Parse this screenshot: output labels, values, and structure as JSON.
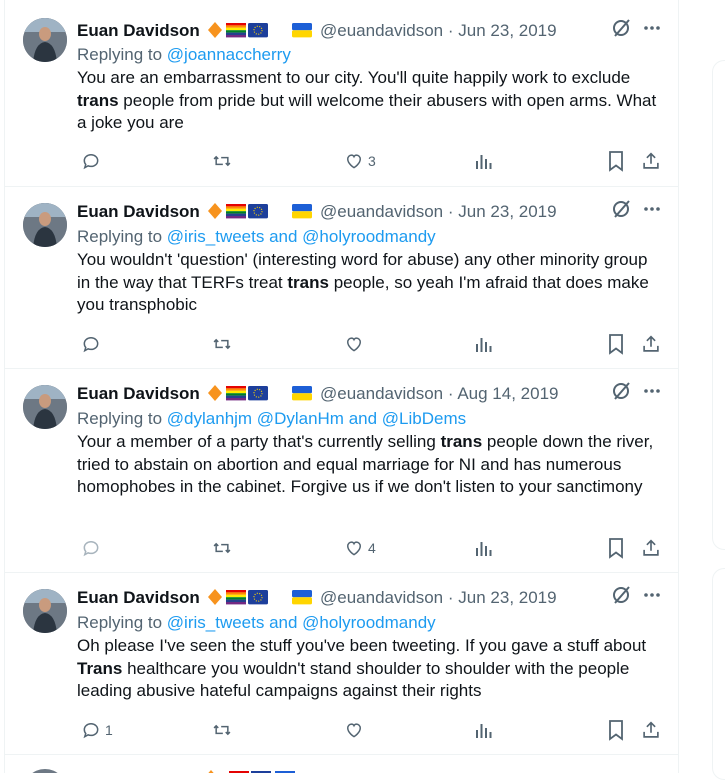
{
  "tweets": [
    {
      "name": "Euan Davidson",
      "handle": "@euandavidson",
      "date": "· Jun 23, 2019",
      "reply_prefix": "Replying to",
      "reply_to": "@joannaccherry",
      "text_parts": [
        "You are an embarrassment to our city. You'll quite happily work to exclude ",
        "trans",
        " people from pride but will welcome their abusers with open arms. What a joke you are"
      ],
      "reply_count": "",
      "like_count": "3"
    },
    {
      "name": "Euan Davidson",
      "handle": "@euandavidson",
      "date": "· Jun 23, 2019",
      "reply_prefix": "Replying to",
      "reply_to": "@iris_tweets and @holyroodmandy",
      "text_parts": [
        "You wouldn't 'question' (interesting word for abuse) any other minority group in the way that TERFs treat ",
        "trans",
        " people, so yeah I'm afraid that does make you transphobic"
      ],
      "reply_count": "",
      "like_count": ""
    },
    {
      "name": "Euan Davidson",
      "handle": "@euandavidson",
      "date": "· Aug 14, 2019",
      "reply_prefix": "Replying to",
      "reply_to": "@dylanhjm @DylanHm and @LibDems",
      "text_parts": [
        "Your a member of a party that's currently selling ",
        "trans",
        " people down the river, tried to abstain on abortion and equal marriage for NI and has numerous homophobes in the cabinet. Forgive us if we don't listen to your sanctimony"
      ],
      "reply_count": "",
      "like_count": "4"
    },
    {
      "name": "Euan Davidson",
      "handle": "@euandavidson",
      "date": "· Jun 23, 2019",
      "reply_prefix": "Replying to",
      "reply_to": "@iris_tweets and @holyroodmandy",
      "text_parts": [
        "Oh please I've seen the stuff you've been tweeting. If you gave a stuff about ",
        "Trans",
        " healthcare you wouldn't stand shoulder to shoulder with the people leading abusive hateful campaigns against their rights"
      ],
      "reply_count": "1",
      "like_count": ""
    }
  ],
  "icons": {
    "reply": "reply-bubble-icon",
    "retweet": "retweet-icon",
    "like": "heart-icon",
    "views": "analytics-bars-icon",
    "bookmark": "bookmark-icon",
    "share": "share-upload-icon",
    "grok": "grok-slash-icon",
    "more": "more-dots-icon"
  },
  "colors": {
    "text": "#0f1419",
    "secondary": "#536471",
    "link": "#1d9bf0",
    "border": "#eff3f4",
    "diamond": "#f7931e",
    "ukraine_blue": "#1d5fd6",
    "ukraine_yellow": "#ffd500",
    "eu_blue": "#1d3f9b"
  }
}
